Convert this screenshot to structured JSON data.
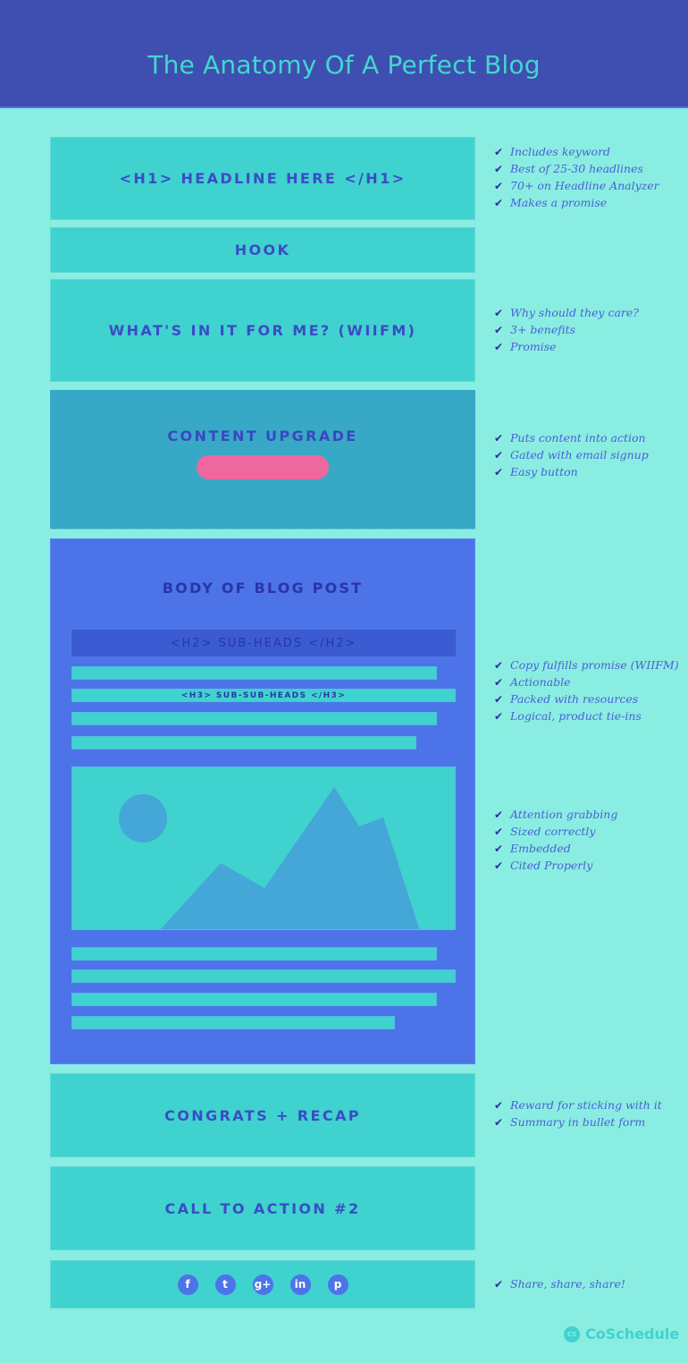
{
  "header": {
    "title": "The Anatomy Of A Perfect Blog"
  },
  "colors": {
    "header_bg": "#3e4fb1",
    "title_text": "#44d6cc",
    "page_bg": "#8aede1",
    "block_bg": "#40d2ce",
    "upgrade_bg": "#37a9c6",
    "body_bg": "#4c74e8",
    "h2_bg": "#3a5bd2",
    "button_pink": "#ee679e",
    "label_text": "#3a4cc5",
    "check_text": "#4b5fd8",
    "check_icon": "#2a2f9e"
  },
  "blocks": {
    "headline": "<H1>  HEADLINE HERE  </H1>",
    "hook": "HOOK",
    "wiifm": "WHAT'S IN IT FOR ME? (WIIFM)",
    "content_upgrade": "CONTENT UPGRADE",
    "body": {
      "title": "BODY OF BLOG POST",
      "h2": "<H2>  SUB-HEADS  </H2>",
      "h3": "<H3>  SUB-SUB-HEADS  </H3>",
      "image_icon": "landscape-image-icon"
    },
    "congrats": "CONGRATS + RECAP",
    "cta": "CALL TO ACTION #2",
    "social": [
      "facebook-icon",
      "twitter-icon",
      "google-plus-icon",
      "linkedin-icon",
      "pinterest-icon"
    ],
    "social_glyphs": [
      "f",
      "t",
      "g+",
      "in",
      "p"
    ]
  },
  "checklists": {
    "headline": [
      "Includes keyword",
      "Best of 25-30 headlines",
      "70+ on Headline Analyzer",
      "Makes a promise"
    ],
    "wiifm": [
      "Why should they care?",
      "3+ benefits",
      "Promise"
    ],
    "content_upgrade": [
      "Puts content into action",
      "Gated with email signup",
      "Easy button"
    ],
    "body": [
      "Copy fulfills promise (WIIFM)",
      "Actionable",
      "Packed with resources",
      "Logical, product tie-ins"
    ],
    "image": [
      "Attention grabbing",
      "Sized correctly",
      "Embedded",
      "Cited Properly"
    ],
    "congrats": [
      "Reward for sticking with it",
      "Summary in bullet form"
    ],
    "social": [
      "Share, share, share!"
    ]
  },
  "check_glyph": "✔",
  "brand": {
    "logo_text": "CS",
    "name": "CoSchedule"
  }
}
